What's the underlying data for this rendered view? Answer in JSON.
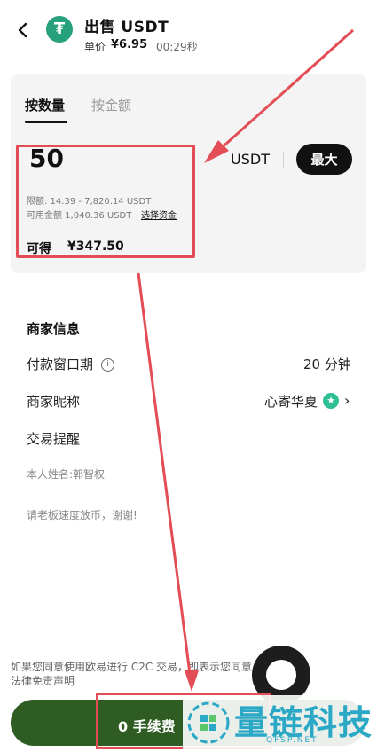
{
  "header": {
    "title": "出售 USDT",
    "price_label": "单价",
    "price_value": "¥6.95",
    "timer": "00:29秒",
    "coin_glyph": "₮"
  },
  "tabs": {
    "by_quantity": "按数量",
    "by_amount": "按金额"
  },
  "input": {
    "amount": "50",
    "unit": "USDT",
    "max_label": "最大",
    "limit": "限额: 14.39 - 7,820.14 USDT",
    "available": "可用金额 1,040.36 USDT",
    "select_funds": "选择资金",
    "receive_label": "可得",
    "receive_value": "¥347.50"
  },
  "merchant": {
    "section_title": "商家信息",
    "payment_window_label": "付款窗口期",
    "payment_window_value": "20 分钟",
    "nickname_label": "商家昵称",
    "nickname_value": "心寄华夏",
    "reminder_label": "交易提醒",
    "note1": "本人姓名:郭智权",
    "note2": "请老板速度放币，谢谢!"
  },
  "disclaimer": {
    "line1": "如果您同意使用欧易进行 C2C 交易，即表示您同意 C2C 交易",
    "line2": "法律免责声明"
  },
  "bottom": {
    "fee": "0 手续费"
  },
  "watermark": {
    "title": "量链科技",
    "url": "QFSP.NET"
  },
  "colors": {
    "accent_green": "#2e5c22",
    "annotation_red": "#e34d55",
    "tether_green": "#26a17b",
    "watermark_blue": "#2aa8c6"
  }
}
